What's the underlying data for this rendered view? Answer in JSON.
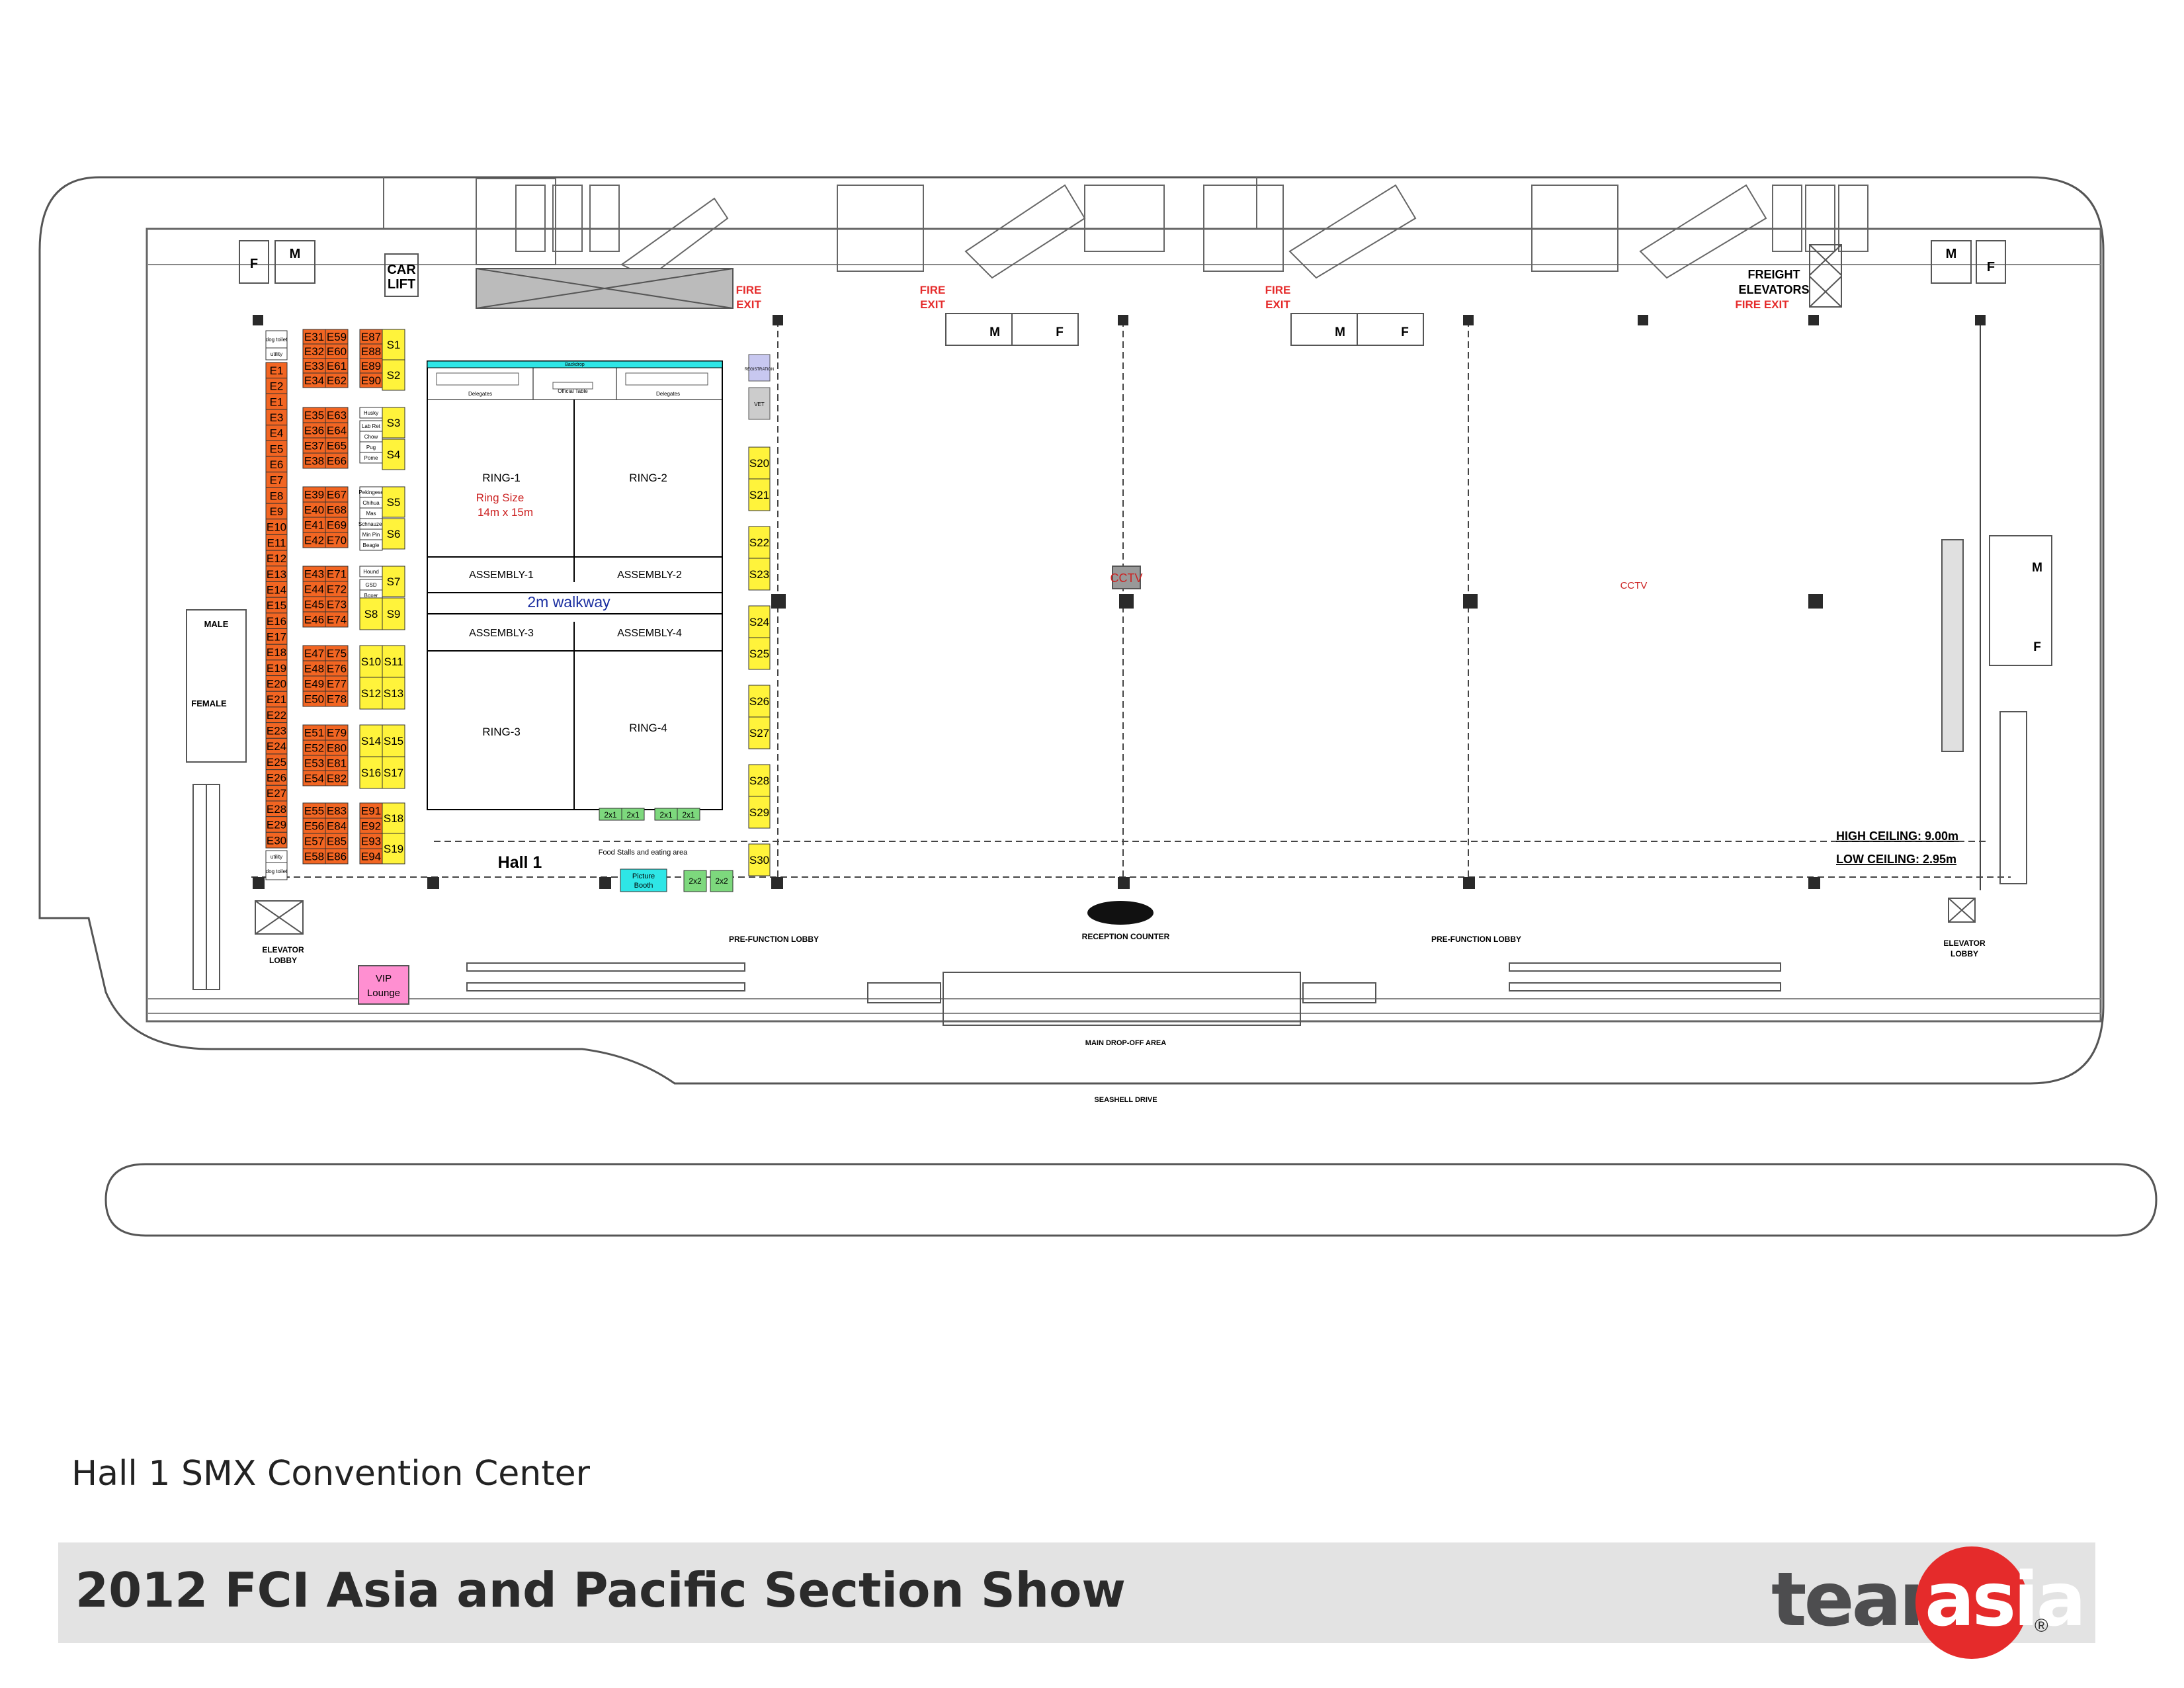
{
  "caption": "Hall 1 SMX Convention Center",
  "show_title": "2012 FCI Asia and Pacific Section Show",
  "logo": {
    "team": "team",
    "asia": "asia",
    "registered": "®"
  },
  "colors": {
    "exhibitor": "#f26522",
    "sponsor": "#fff33b",
    "ring_line": "#000000",
    "stage": "#2ee6e6",
    "stall": "#7dd87d",
    "vip": "#ff8fd1",
    "fire_exit": "#e52b2b",
    "walkway_text": "#1a2ea0",
    "ring_note": "#cc2222"
  },
  "labels": {
    "fire_exit_1": "FIRE",
    "fire_exit_2": "EXIT",
    "fire_exit_single": "FIRE EXIT",
    "freight_1": "FREIGHT",
    "freight_2": "ELEVATORS",
    "car_lift_1": "CAR",
    "car_lift_2": "LIFT",
    "male_room": "M",
    "female_room": "F",
    "male": "MALE",
    "female": "FEMALE",
    "hall": "Hall 1",
    "walkway": "2m walkway",
    "ring_size_1": "Ring Size",
    "ring_size_2": "14m x 15m",
    "cctv": "CCTV",
    "high_ceiling": "HIGH CEILING: 9.00m",
    "low_ceiling": "LOW CEILING: 2.95m",
    "prefunction": "PRE-FUNCTION LOBBY",
    "reception": "RECEPTION COUNTER",
    "elevator_1": "ELEVATOR",
    "elevator_2": "LOBBY",
    "dropoff": "MAIN DROP-OFF AREA",
    "seashell": "SEASHELL DRIVE",
    "vip_1": "VIP",
    "vip_2": "Lounge",
    "picture_1": "Picture",
    "picture_2": "Booth",
    "food": "Food Stalls and eating area",
    "registration": "REGISTRATION",
    "vet": "VET",
    "backdrop": "Backdrop",
    "delegates": "Delegates",
    "official_table": "Official Table",
    "dog_toilet": "dog toilet",
    "utility": "utility",
    "stall_2x1": "2x1",
    "stall_2x2": "2x2"
  },
  "rings": [
    "RING-1",
    "RING-2",
    "RING-3",
    "RING-4"
  ],
  "assemblies": [
    "ASSEMBLY-1",
    "ASSEMBLY-2",
    "ASSEMBLY-3",
    "ASSEMBLY-4"
  ],
  "breed_tags": [
    "Husky",
    "Lab Ret",
    "Chow",
    "Pug",
    "Pome",
    "Pekingese",
    "Chihua",
    "Mas",
    "Schnauzer",
    "Min Pin",
    "Beagle",
    "Hound",
    "GSD",
    "Boxer",
    "Dobe"
  ],
  "exhibitor_booths": {
    "col1": [
      "E1",
      "E2",
      "E1",
      "E3",
      "E4",
      "E5",
      "E6",
      "E7",
      "E8",
      "E9",
      "E10",
      "E11",
      "E12",
      "E13",
      "E14",
      "E15",
      "E16",
      "E17",
      "E18",
      "E19",
      "E20",
      "E21",
      "E22",
      "E23",
      "E24",
      "E25",
      "E26",
      "E27",
      "E28",
      "E29",
      "E30"
    ],
    "col2_top": [
      "E31",
      "E32",
      "E33",
      "E34"
    ],
    "col3_top": [
      "E59",
      "E60",
      "E61",
      "E62"
    ],
    "col4_top": [
      "E87",
      "E88",
      "E89",
      "E90"
    ],
    "col2": [
      "E35",
      "E36",
      "E37",
      "E38",
      "E39",
      "E40",
      "E41",
      "E42",
      "E43",
      "E44",
      "E45",
      "E46",
      "E47",
      "E48",
      "E49",
      "E50",
      "E51",
      "E52",
      "E53",
      "E54",
      "E55",
      "E56",
      "E57",
      "E58"
    ],
    "col3": [
      "E63",
      "E64",
      "E65",
      "E66",
      "E67",
      "E68",
      "E69",
      "E70",
      "E71",
      "E72",
      "E73",
      "E74",
      "E75",
      "E76",
      "E77",
      "E78",
      "E79",
      "E80",
      "E81",
      "E82",
      "E83",
      "E84",
      "E85",
      "E86"
    ],
    "col4_bottom": [
      "E91",
      "E92",
      "E93",
      "E94"
    ]
  },
  "sponsor_booths": {
    "left_single": [
      "S1",
      "S2",
      "S3",
      "S4",
      "S5",
      "S6",
      "S7"
    ],
    "left_pairs": [
      [
        "S8",
        "S9"
      ],
      [
        "S10",
        "S11"
      ],
      [
        "S12",
        "S13"
      ],
      [
        "S14",
        "S15"
      ],
      [
        "S16",
        "S17"
      ]
    ],
    "left_bottom": [
      "S18",
      "S19"
    ],
    "right": [
      "S20",
      "S21",
      "S22",
      "S23",
      "S24",
      "S25",
      "S26",
      "S27",
      "S28",
      "S29",
      "S30"
    ]
  }
}
